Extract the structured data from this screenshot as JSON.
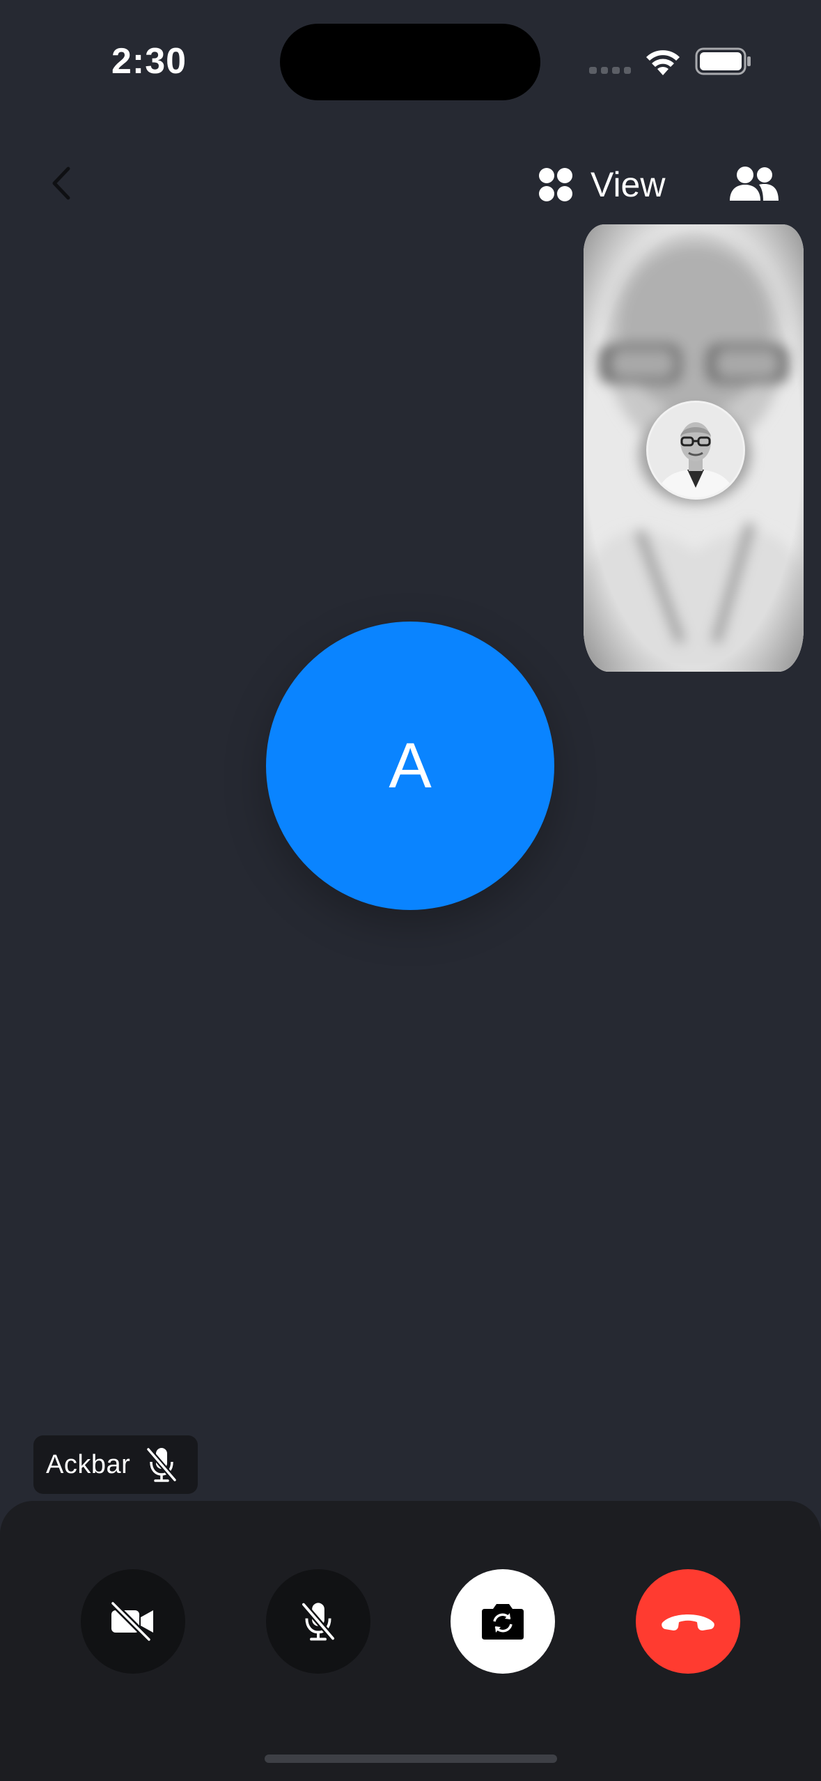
{
  "status_bar": {
    "time": "2:30",
    "icons": [
      "cellular-signal-icon",
      "wifi-icon",
      "battery-icon"
    ]
  },
  "header": {
    "back_icon": "chevron-left-icon",
    "view_label": "View",
    "view_icon": "grid-dots-icon",
    "participants_icon": "people-icon"
  },
  "main": {
    "avatar_initial": "A",
    "avatar_color": "#0a84ff"
  },
  "remote_participant": {
    "icon": "profile-photo"
  },
  "name_tag": {
    "name": "Ackbar",
    "icon": "mic-off-icon"
  },
  "controls": [
    {
      "name": "camera-off-button",
      "icon": "video-off-icon"
    },
    {
      "name": "mute-button",
      "icon": "mic-off-icon"
    },
    {
      "name": "flip-camera-button",
      "icon": "camera-rotate-icon"
    },
    {
      "name": "end-call-button",
      "icon": "phone-hangup-icon",
      "color": "#ff3b30"
    }
  ]
}
